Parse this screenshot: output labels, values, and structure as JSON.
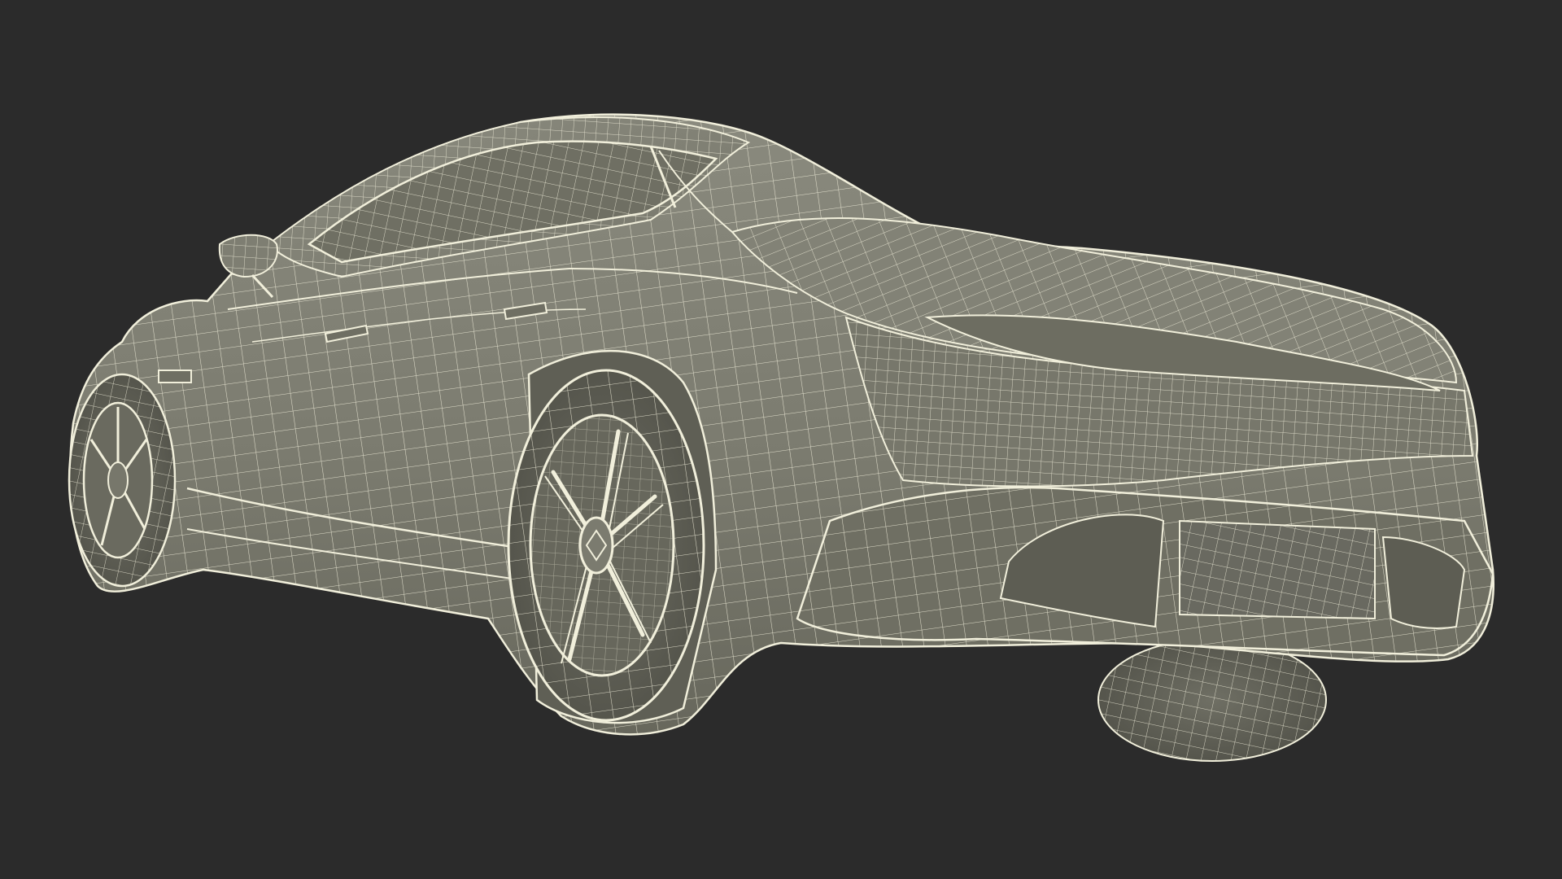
{
  "scene": {
    "background_color": "#2b2b2b",
    "surface_color": "#7b7b6f",
    "surface_shadow_color": "#5d5d53",
    "wire_color": "#f1efdb",
    "subject": "car-wireframe-render"
  }
}
